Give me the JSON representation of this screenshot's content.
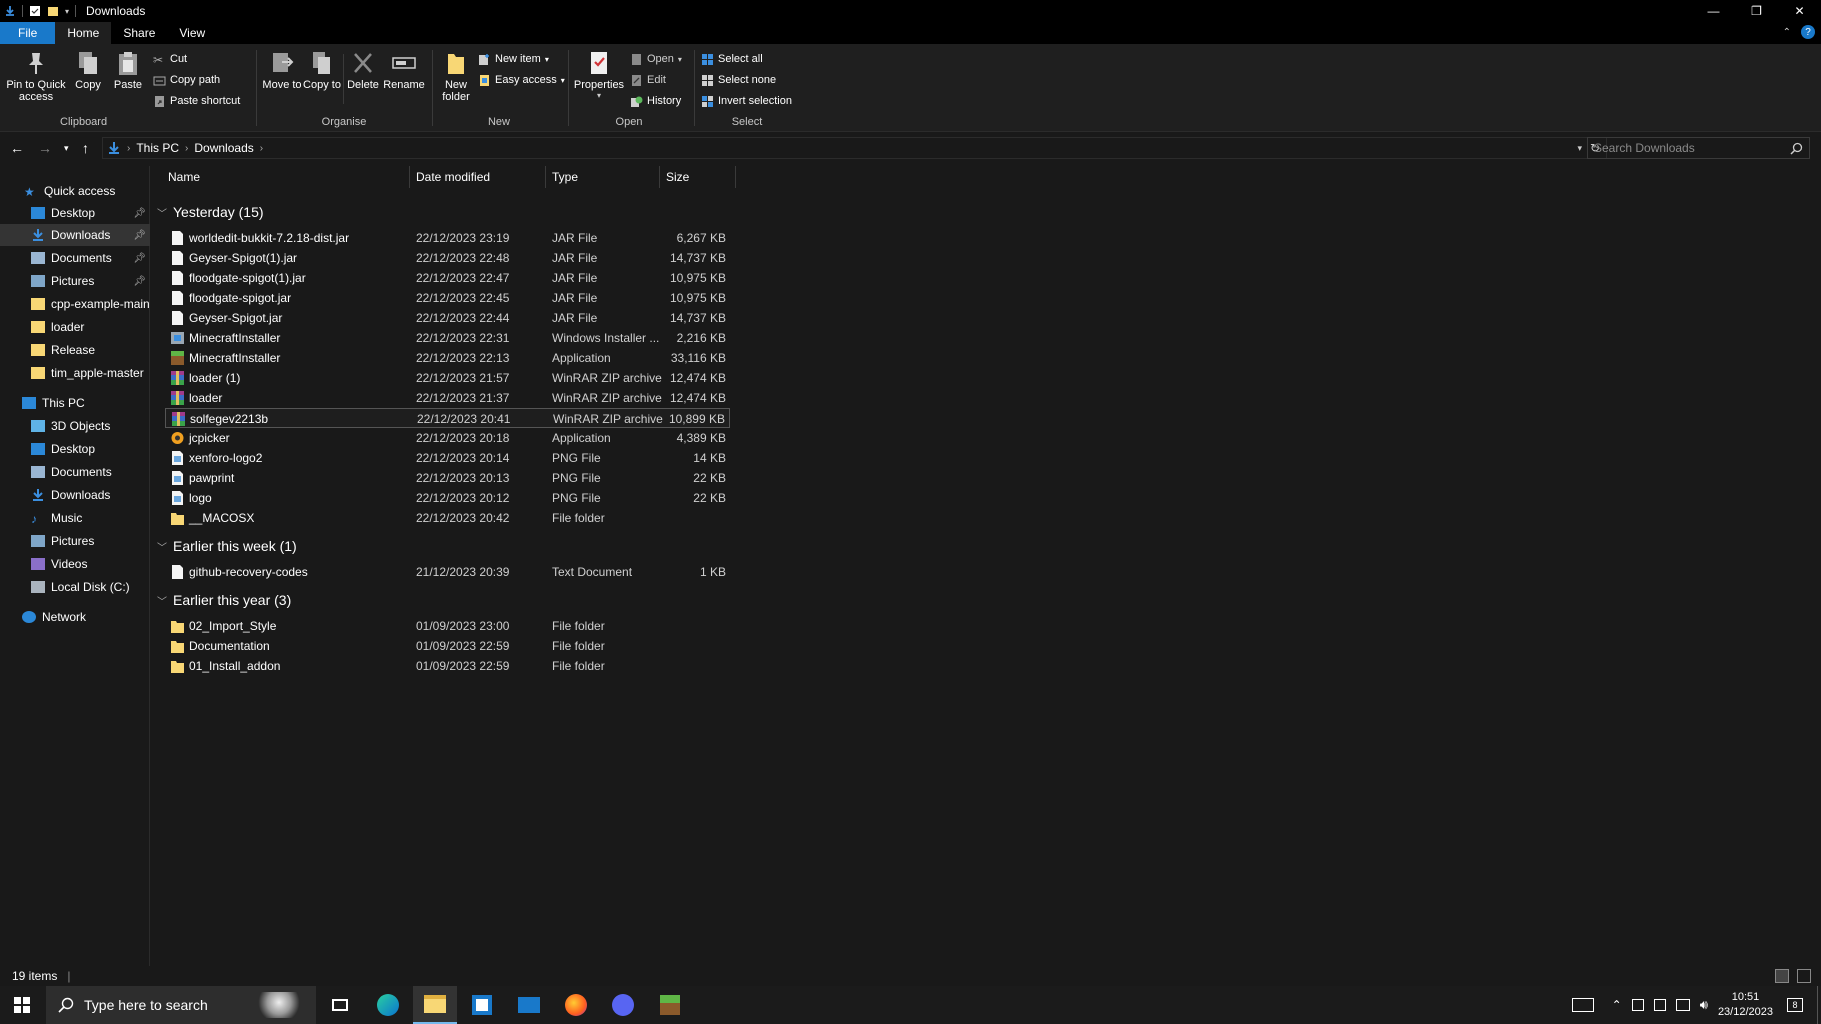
{
  "window": {
    "title": "Downloads",
    "controls": [
      "minimize",
      "restore",
      "close"
    ]
  },
  "ribbon_tabs": [
    {
      "label": "File"
    },
    {
      "label": "Home"
    },
    {
      "label": "Share"
    },
    {
      "label": "View"
    }
  ],
  "ribbon": {
    "clipboard": {
      "label": "Clipboard",
      "pin": "Pin to Quick access",
      "copy": "Copy",
      "paste": "Paste",
      "cut": "Cut",
      "copy_path": "Copy path",
      "paste_shortcut": "Paste shortcut"
    },
    "organise": {
      "label": "Organise",
      "move_to": "Move to",
      "copy_to": "Copy to",
      "delete": "Delete",
      "rename": "Rename"
    },
    "new": {
      "label": "New",
      "new_folder": "New folder",
      "new_item": "New item",
      "easy_access": "Easy access"
    },
    "open": {
      "label": "Open",
      "properties": "Properties",
      "open": "Open",
      "edit": "Edit",
      "history": "History"
    },
    "select": {
      "label": "Select",
      "select_all": "Select all",
      "select_none": "Select none",
      "invert_selection": "Invert selection"
    }
  },
  "address": {
    "crumbs": [
      "This PC",
      "Downloads"
    ],
    "search_placeholder": "Search Downloads"
  },
  "nav": {
    "quick_access": "Quick access",
    "quick_items": [
      {
        "label": "Desktop",
        "pinned": true
      },
      {
        "label": "Downloads",
        "pinned": true
      },
      {
        "label": "Documents",
        "pinned": true
      },
      {
        "label": "Pictures",
        "pinned": true
      },
      {
        "label": "cpp-example-main",
        "pinned": false
      },
      {
        "label": "loader",
        "pinned": false
      },
      {
        "label": "Release",
        "pinned": false
      },
      {
        "label": "tim_apple-master",
        "pinned": false
      }
    ],
    "this_pc": "This PC",
    "pc_items": [
      {
        "label": "3D Objects"
      },
      {
        "label": "Desktop"
      },
      {
        "label": "Documents"
      },
      {
        "label": "Downloads"
      },
      {
        "label": "Music"
      },
      {
        "label": "Pictures"
      },
      {
        "label": "Videos"
      },
      {
        "label": "Local Disk (C:)"
      }
    ],
    "network": "Network"
  },
  "columns": {
    "name": "Name",
    "date": "Date modified",
    "type": "Type",
    "size": "Size"
  },
  "groups": [
    {
      "label": "Yesterday (15)",
      "files": [
        {
          "name": "worldedit-bukkit-7.2.18-dist.jar",
          "date": "22/12/2023 23:19",
          "type": "JAR File",
          "size": "6,267 KB",
          "icon": "file-icon"
        },
        {
          "name": "Geyser-Spigot(1).jar",
          "date": "22/12/2023 22:48",
          "type": "JAR File",
          "size": "14,737 KB",
          "icon": "file-icon"
        },
        {
          "name": "floodgate-spigot(1).jar",
          "date": "22/12/2023 22:47",
          "type": "JAR File",
          "size": "10,975 KB",
          "icon": "file-icon"
        },
        {
          "name": "floodgate-spigot.jar",
          "date": "22/12/2023 22:45",
          "type": "JAR File",
          "size": "10,975 KB",
          "icon": "file-icon"
        },
        {
          "name": "Geyser-Spigot.jar",
          "date": "22/12/2023 22:44",
          "type": "JAR File",
          "size": "14,737 KB",
          "icon": "file-icon"
        },
        {
          "name": "MinecraftInstaller",
          "date": "22/12/2023 22:31",
          "type": "Windows Installer ...",
          "size": "2,216 KB",
          "icon": "msi-icon"
        },
        {
          "name": "MinecraftInstaller",
          "date": "22/12/2023 22:13",
          "type": "Application",
          "size": "33,116 KB",
          "icon": "minecraft-icon"
        },
        {
          "name": "loader (1)",
          "date": "22/12/2023 21:57",
          "type": "WinRAR ZIP archive",
          "size": "12,474 KB",
          "icon": "winrar-icon"
        },
        {
          "name": "loader",
          "date": "22/12/2023 21:37",
          "type": "WinRAR ZIP archive",
          "size": "12,474 KB",
          "icon": "winrar-icon"
        },
        {
          "name": "solfegev2213b",
          "date": "22/12/2023 20:41",
          "type": "WinRAR ZIP archive",
          "size": "10,899 KB",
          "icon": "winrar-icon"
        },
        {
          "name": "jcpicker",
          "date": "22/12/2023 20:18",
          "type": "Application",
          "size": "4,389 KB",
          "icon": "app-icon"
        },
        {
          "name": "xenforo-logo2",
          "date": "22/12/2023 20:14",
          "type": "PNG File",
          "size": "14 KB",
          "icon": "image-icon"
        },
        {
          "name": "pawprint",
          "date": "22/12/2023 20:13",
          "type": "PNG File",
          "size": "22 KB",
          "icon": "image-icon"
        },
        {
          "name": "logo",
          "date": "22/12/2023 20:12",
          "type": "PNG File",
          "size": "22 KB",
          "icon": "image-icon"
        },
        {
          "name": "__MACOSX",
          "date": "22/12/2023 20:42",
          "type": "File folder",
          "size": "",
          "icon": "folder-icon"
        }
      ]
    },
    {
      "label": "Earlier this week (1)",
      "files": [
        {
          "name": "github-recovery-codes",
          "date": "21/12/2023 20:39",
          "type": "Text Document",
          "size": "1 KB",
          "icon": "file-icon"
        }
      ]
    },
    {
      "label": "Earlier this year (3)",
      "files": [
        {
          "name": "02_Import_Style",
          "date": "01/09/2023 23:00",
          "type": "File folder",
          "size": "",
          "icon": "folder-icon"
        },
        {
          "name": "Documentation",
          "date": "01/09/2023 22:59",
          "type": "File folder",
          "size": "",
          "icon": "folder-icon"
        },
        {
          "name": "01_Install_addon",
          "date": "01/09/2023 22:59",
          "type": "File folder",
          "size": "",
          "icon": "folder-icon"
        }
      ]
    }
  ],
  "hovered_row": "solfegev2213b",
  "status": {
    "items": "19 items"
  },
  "taskbar": {
    "search_placeholder": "Type here to search",
    "apps": [
      "task-view-icon",
      "edge-icon",
      "file-explorer-icon",
      "store-icon",
      "mail-icon",
      "firefox-icon",
      "discord-icon",
      "minecraft-icon"
    ],
    "active_app": "file-explorer-icon",
    "time": "10:51",
    "date": "23/12/2023",
    "notifications": "8"
  },
  "colors": {
    "accent": "#1979ca",
    "background": "#191919",
    "ribbon": "#1f1f1f",
    "folder": "#f8d775"
  }
}
